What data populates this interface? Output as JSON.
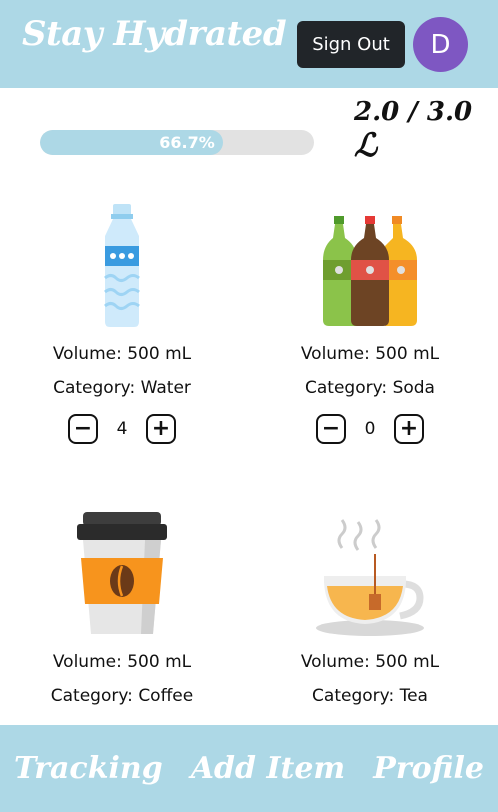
{
  "header": {
    "title": "Stay Hydrated",
    "signout_label": "Sign Out",
    "avatar_initial": "D"
  },
  "progress": {
    "percent_label": "66.7%",
    "fraction": 0.667,
    "consumed": "2.0",
    "goal": "3.0",
    "separator": "/",
    "unit": "ℒ"
  },
  "drinks": [
    {
      "name": "Water bottle",
      "volume": "Volume: 500 mL",
      "category": "Category: Water",
      "quantity": "4",
      "icon": "water-bottle-icon"
    },
    {
      "name": "Soda bottles",
      "volume": "Volume: 500 mL",
      "category": "Category: Soda",
      "quantity": "0",
      "icon": "soda-bottles-icon"
    },
    {
      "name": "Coffee cup",
      "volume": "Volume: 500 mL",
      "category": "Category: Coffee",
      "icon": "coffee-cup-icon"
    },
    {
      "name": "Tea cup",
      "volume": "Volume: 500 mL",
      "category": "Category: Tea",
      "icon": "tea-cup-icon"
    }
  ],
  "stepper": {
    "minus": "−",
    "plus": "+"
  },
  "nav": {
    "tracking": "Tracking",
    "add_item": "Add Item",
    "profile": "Profile"
  },
  "colors": {
    "header": "#add8e6",
    "signout_bg": "#212529",
    "avatar_bg": "#7e57c2",
    "track": "#e2e2e2"
  }
}
